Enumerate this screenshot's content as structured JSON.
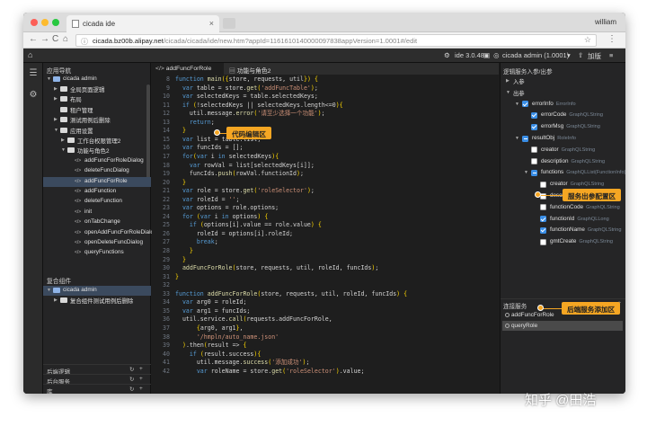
{
  "browser": {
    "tab_title": "cicada ide",
    "tab_close": "×",
    "user": "william",
    "url_host": "cicada.bz00b.alipay.net",
    "url_path": "/cicada/cicada/ide/new.htm?appId=1161610140000097838appVersion=1.0001#/edit",
    "back": "←",
    "forward": "→",
    "reload": "C",
    "home": "⌂"
  },
  "ide_top": {
    "home_icon": "home-icon",
    "ide_version": "ide 3.0.48",
    "save_icon": "save-icon",
    "app_name": "cicada admin (1.0001)",
    "publish": "加版"
  },
  "sidebar": {
    "nav_header": "应用导航",
    "app_root": "cicada admin",
    "items": [
      {
        "label": "全局页面逻辑",
        "type": "folder"
      },
      {
        "label": "布局",
        "type": "folder"
      },
      {
        "label": "租户管理",
        "type": "folder"
      },
      {
        "label": "测试用例后删除",
        "type": "folder"
      },
      {
        "label": "应用设置",
        "type": "folder"
      },
      {
        "label": "工作台权限管理2",
        "type": "folder"
      },
      {
        "label": "功能与角色2",
        "type": "folder"
      },
      {
        "label": "addFuncForRoleDialog",
        "type": "file"
      },
      {
        "label": "deleteFuncDialog",
        "type": "file"
      },
      {
        "label": "addFuncForRole",
        "type": "file"
      },
      {
        "label": "addFunction",
        "type": "file"
      },
      {
        "label": "deleteFunction",
        "type": "file"
      },
      {
        "label": "init",
        "type": "file"
      },
      {
        "label": "onTabChange",
        "type": "file"
      },
      {
        "label": "openAddFuncForRoleDialog",
        "type": "file"
      },
      {
        "label": "openDeleteFuncDialog",
        "type": "file"
      },
      {
        "label": "queryFunctions",
        "type": "file"
      }
    ],
    "composite_header": "复合组件",
    "composite_root": "cicada admin",
    "composite_items": [
      {
        "label": "复合组件测试用例后删除",
        "type": "folder"
      }
    ],
    "bottom": [
      {
        "label": "后端逻辑"
      },
      {
        "label": "后台服务"
      },
      {
        "label": "库"
      }
    ]
  },
  "editor": {
    "tabs": [
      {
        "label": "addFuncForRole"
      },
      {
        "label": "功能与角色2"
      }
    ],
    "lines": [
      {
        "n": "8",
        "t": "function main({store, requests, util}) {"
      },
      {
        "n": "9",
        "t": "  var table = store.get('addFuncTable');"
      },
      {
        "n": "10",
        "t": "  var selectedKeys = table.selectedKeys;"
      },
      {
        "n": "11",
        "t": "  if (!selectedKeys || selectedKeys.length<=0){"
      },
      {
        "n": "12",
        "t": "    util.message.error('请至少选择一个功能');"
      },
      {
        "n": "13",
        "t": "    return;"
      },
      {
        "n": "14",
        "t": "  }"
      },
      {
        "n": "15",
        "t": "  var list = table.list;"
      },
      {
        "n": "16",
        "t": "  var funcIds = [];"
      },
      {
        "n": "17",
        "t": "  for(var i in selectedKeys){"
      },
      {
        "n": "18",
        "t": "    var rowVal = list[selectedKeys[i]];"
      },
      {
        "n": "19",
        "t": "    funcIds.push(rowVal.functionId);"
      },
      {
        "n": "20",
        "t": "  }"
      },
      {
        "n": "21",
        "t": "  var role = store.get('roleSelector');"
      },
      {
        "n": "22",
        "t": "  var roleId = '';"
      },
      {
        "n": "23",
        "t": "  var options = role.options;"
      },
      {
        "n": "24",
        "t": "  for (var i in options) {"
      },
      {
        "n": "25",
        "t": "    if (options[i].value == role.value) {"
      },
      {
        "n": "26",
        "t": "      roleId = options[i].roleId;"
      },
      {
        "n": "27",
        "t": "      break;"
      },
      {
        "n": "28",
        "t": "    }"
      },
      {
        "n": "29",
        "t": "  }"
      },
      {
        "n": "30",
        "t": "  addFuncForRole(store, requests, util, roleId, funcIds);"
      },
      {
        "n": "31",
        "t": "}"
      },
      {
        "n": "32",
        "t": ""
      },
      {
        "n": "33",
        "t": "function addFuncForRole(store, requests, util, roleId, funcIds) {"
      },
      {
        "n": "34",
        "t": "  var arg0 = roleId;"
      },
      {
        "n": "35",
        "t": "  var arg1 = funcIds;"
      },
      {
        "n": "36",
        "t": "  util.service.call(requests.addFuncForRole,"
      },
      {
        "n": "37",
        "t": "      {arg0, arg1},"
      },
      {
        "n": "38",
        "t": "      '/hmpln/auto_name.json'"
      },
      {
        "n": "39",
        "t": "  ).then(result => {"
      },
      {
        "n": "40",
        "t": "    if (result.success){"
      },
      {
        "n": "41",
        "t": "      util.message.success('添加成功');"
      },
      {
        "n": "42",
        "t": "      var roleName = store.get('roleSelector').value;"
      }
    ]
  },
  "rpanel": {
    "header": "逻辑服务入参/出参",
    "rows": [
      {
        "name": "入参",
        "type": "",
        "indent": 0,
        "arrow": "▶",
        "cb": ""
      },
      {
        "name": "出参",
        "type": "",
        "indent": 0,
        "arrow": "▼",
        "cb": ""
      },
      {
        "name": "errorInfo",
        "type": "ErrorInfo",
        "indent": 1,
        "arrow": "▼",
        "cb": "on"
      },
      {
        "name": "errorCode",
        "type": "GraphQLString",
        "indent": 2,
        "arrow": "",
        "cb": "on"
      },
      {
        "name": "errorMsg",
        "type": "GraphQLString",
        "indent": 2,
        "arrow": "",
        "cb": "on"
      },
      {
        "name": "resultObj",
        "type": "RoleInfo",
        "indent": 1,
        "arrow": "▼",
        "cb": "part"
      },
      {
        "name": "creator",
        "type": "GraphQLString",
        "indent": 2,
        "arrow": "",
        "cb": "off"
      },
      {
        "name": "description",
        "type": "GraphQLString",
        "indent": 2,
        "arrow": "",
        "cb": "off"
      },
      {
        "name": "functions",
        "type": "GraphQLList(FunctionInfo)",
        "indent": 2,
        "arrow": "▼",
        "cb": "part"
      },
      {
        "name": "creator",
        "type": "GraphQLString",
        "indent": 3,
        "arrow": "",
        "cb": "off"
      },
      {
        "name": "description",
        "type": "GraphQLString",
        "indent": 3,
        "arrow": "",
        "cb": "off"
      },
      {
        "name": "functionCode",
        "type": "GraphQLString",
        "indent": 3,
        "arrow": "",
        "cb": "off"
      },
      {
        "name": "functionId",
        "type": "GraphQLLong",
        "indent": 3,
        "arrow": "",
        "cb": "on"
      },
      {
        "name": "functionName",
        "type": "GraphQLString",
        "indent": 3,
        "arrow": "",
        "cb": "on"
      },
      {
        "name": "gmtCreate",
        "type": "GraphQLString",
        "indent": 3,
        "arrow": "",
        "cb": "off"
      }
    ],
    "services_header": "连接服务",
    "services_add": "+",
    "services": [
      {
        "label": "addFuncForRole"
      },
      {
        "label": "queryRole"
      }
    ]
  },
  "callouts": {
    "code_area": "代码编辑区",
    "service_params": "服务出参配置区",
    "backend_add": "后端服务添加区"
  },
  "watermark": "知乎 @田浩",
  "colors": {
    "accent": "#f5a623",
    "keyword": "#569cd6",
    "string": "#ce9178",
    "checkbox": "#3a8ee6"
  }
}
